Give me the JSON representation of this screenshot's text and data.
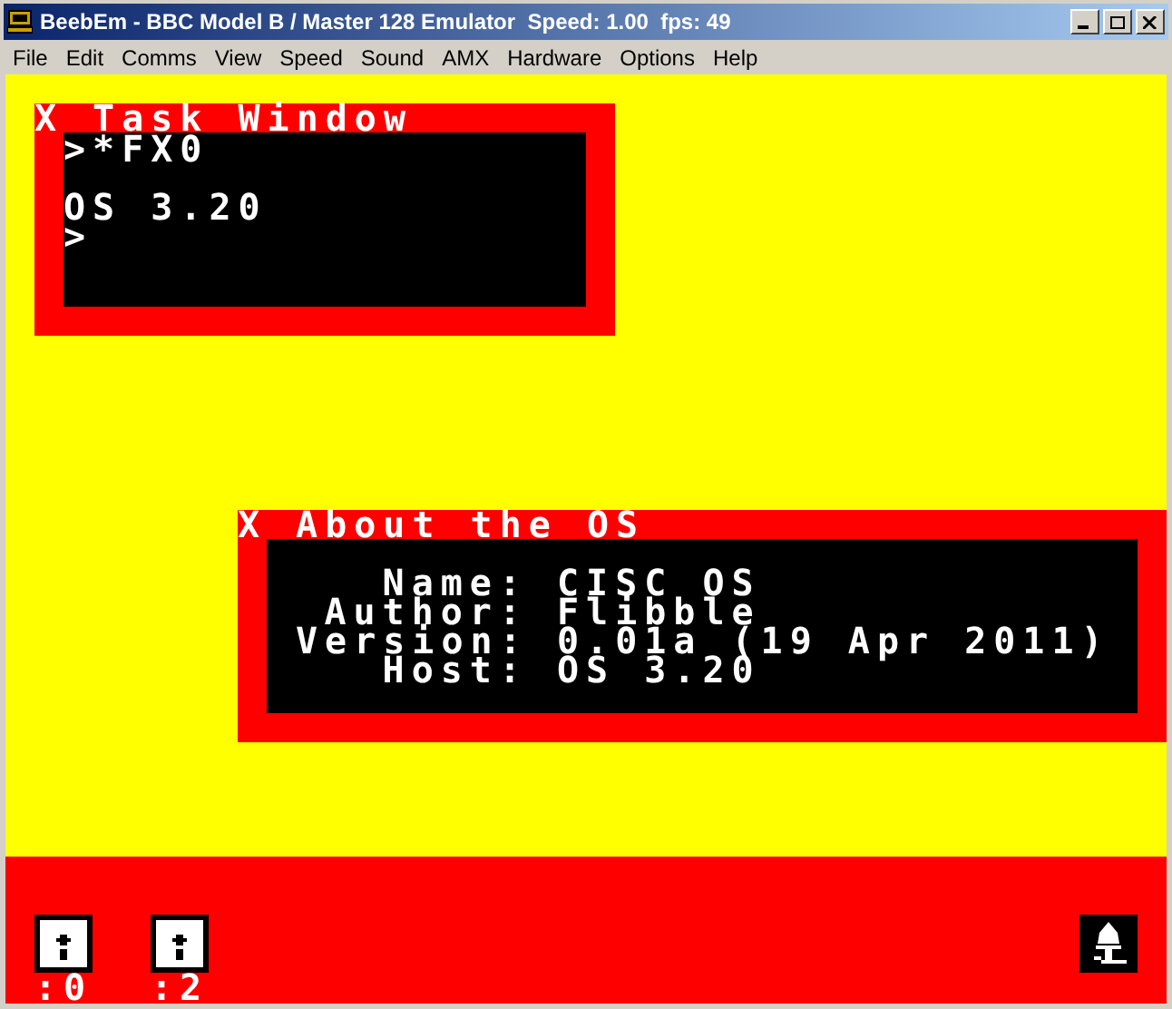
{
  "window": {
    "title": "BeebEm - BBC Model B / Master 128 Emulator  Speed: 1.00  fps: 49"
  },
  "menu": [
    "File",
    "Edit",
    "Comms",
    "View",
    "Speed",
    "Sound",
    "AMX",
    "Hardware",
    "Options",
    "Help"
  ],
  "task_window": {
    "close": "X",
    "title": "Task Window",
    "lines": [
      {
        "text": ">*FX0",
        "blank_before": false
      },
      {
        "text": "OS 3.20",
        "blank_before": true
      },
      {
        "text": ">",
        "blank_before": false
      }
    ]
  },
  "about_window": {
    "close": "X",
    "title": "About the OS",
    "fields": [
      {
        "label": "Name:",
        "value": "CISC OS"
      },
      {
        "label": "Author:",
        "value": "Flibble"
      },
      {
        "label": "Version:",
        "value": "0.01a (19 Apr 2011)"
      },
      {
        "label": "Host:",
        "value": "OS 3.20"
      }
    ]
  },
  "icon_bar": {
    "drives": [
      {
        "label": ":0"
      },
      {
        "label": ":2"
      }
    ]
  }
}
